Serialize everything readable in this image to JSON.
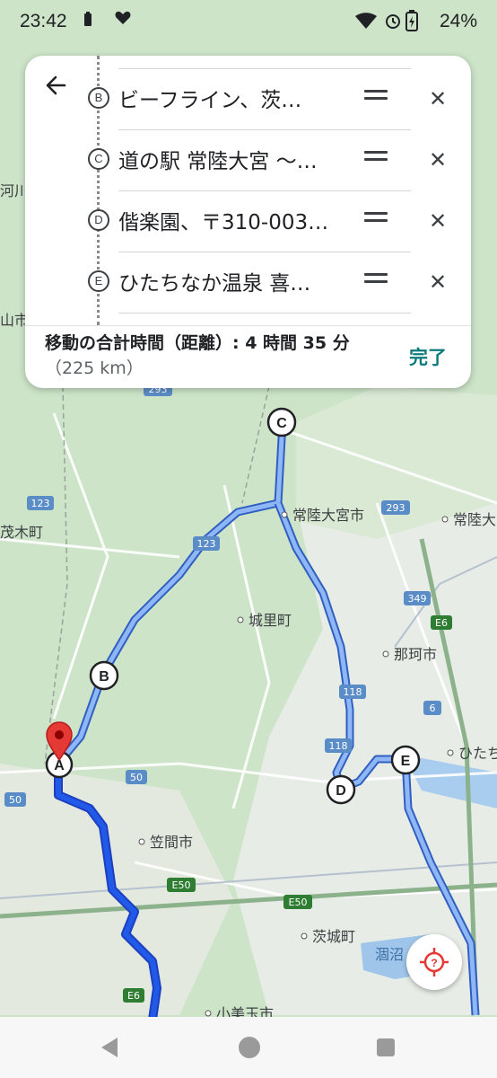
{
  "status_bar": {
    "time": "23:42",
    "battery": "24%"
  },
  "directions": {
    "stops": [
      {
        "letter": "B",
        "name": "ビーフライン、茨…"
      },
      {
        "letter": "C",
        "name": "道の駅 常陸大宮 〜…"
      },
      {
        "letter": "D",
        "name": "偕楽園、〒310-003…"
      },
      {
        "letter": "E",
        "name": "ひたちなか温泉 喜…"
      }
    ],
    "summary_label": "移動の合計時間（距離）: 4 時間 35 分",
    "summary_distance": "（225 km）",
    "done_label": "完了"
  },
  "map": {
    "labels": [
      {
        "id": "hitachiomiya",
        "text": "常陸大宮市"
      },
      {
        "id": "hitachiomiya2",
        "text": "常陸大"
      },
      {
        "id": "shirosato",
        "text": "城里町"
      },
      {
        "id": "naka",
        "text": "那珂市"
      },
      {
        "id": "hitachi",
        "text": "ひたち"
      },
      {
        "id": "kasama",
        "text": "笠間市"
      },
      {
        "id": "ibaraki",
        "text": "茨城町"
      },
      {
        "id": "hinuma",
        "text": "涸沼"
      },
      {
        "id": "motegi",
        "text": "茂木町"
      },
      {
        "id": "kawa",
        "text": "河川"
      },
      {
        "id": "yama",
        "text": "山市"
      },
      {
        "id": "omitama",
        "text": "小美玉市"
      }
    ],
    "road_shields": [
      "293",
      "123",
      "293",
      "349",
      "E6",
      "118",
      "118",
      "6",
      "50",
      "50",
      "E50",
      "E50",
      "E6"
    ],
    "markers": [
      "A",
      "B",
      "C",
      "D",
      "E"
    ]
  },
  "colors": {
    "route": "#4a7bd6",
    "route_primary": "#1d4fd1",
    "accent": "#0b7a7a",
    "pin": "#e53935"
  }
}
